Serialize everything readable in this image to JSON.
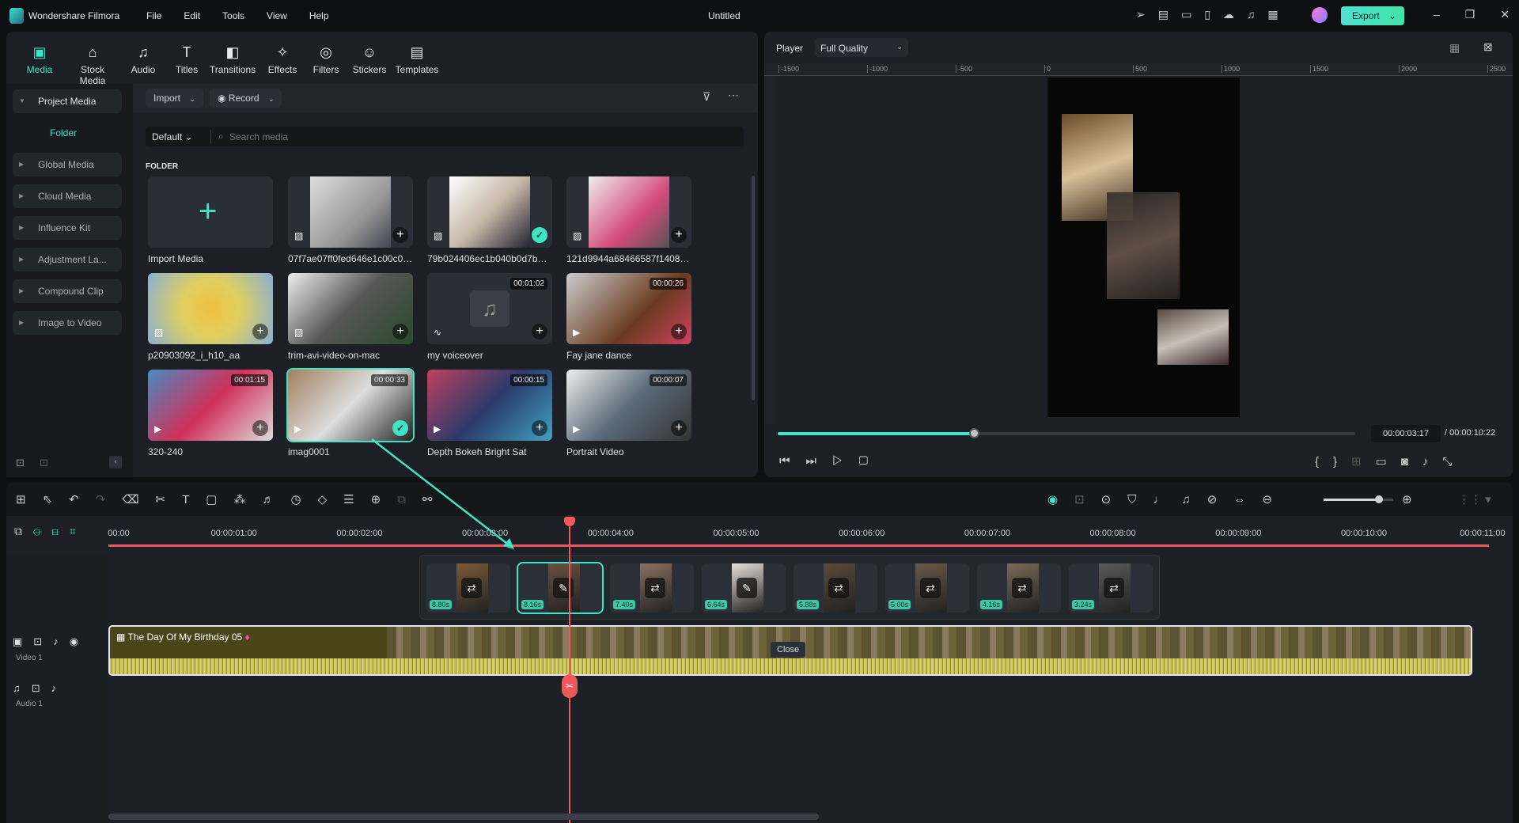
{
  "app": {
    "name": "Wondershare Filmora",
    "title": "Untitled",
    "export_label": "Export"
  },
  "menu": [
    "File",
    "Edit",
    "Tools",
    "View",
    "Help"
  ],
  "toolbar": [
    {
      "label": "Media",
      "icon": "media-icon",
      "active": true
    },
    {
      "label": "Stock Media",
      "icon": "store-icon"
    },
    {
      "label": "Audio",
      "icon": "music-icon"
    },
    {
      "label": "Titles",
      "icon": "text-icon"
    },
    {
      "label": "Transitions",
      "icon": "transition-icon"
    },
    {
      "label": "Effects",
      "icon": "effects-icon"
    },
    {
      "label": "Filters",
      "icon": "filter-icon"
    },
    {
      "label": "Stickers",
      "icon": "sticker-icon"
    },
    {
      "label": "Templates",
      "icon": "template-icon"
    }
  ],
  "sidebar": {
    "project_media": "Project Media",
    "folder": "Folder",
    "items": [
      "Global Media",
      "Cloud Media",
      "Influence Kit",
      "Adjustment La...",
      "Compound Clip",
      "Image to Video"
    ]
  },
  "media": {
    "import": "Import",
    "record": "Record",
    "sort": "Default",
    "search_placeholder": "Search media",
    "section": "FOLDER",
    "items": [
      {
        "name": "Import Media",
        "kind": "import"
      },
      {
        "name": "07f7ae07ff0fed646e1c00c057...",
        "kind": "image"
      },
      {
        "name": "79b024406ec1b040b0d7b8de...",
        "kind": "image",
        "used": true
      },
      {
        "name": "121d9944a68466587f1408607...",
        "kind": "image"
      },
      {
        "name": "p20903092_i_h10_aa",
        "kind": "image"
      },
      {
        "name": "trim-avi-video-on-mac",
        "kind": "image"
      },
      {
        "name": "my voiceover",
        "kind": "audio",
        "duration": "00:01:02"
      },
      {
        "name": "Fay jane dance",
        "kind": "video",
        "duration": "00:00:26"
      },
      {
        "name": "320-240",
        "kind": "video",
        "duration": "00:01:15"
      },
      {
        "name": "imag0001",
        "kind": "video",
        "duration": "00:00:33",
        "used": true,
        "selected": true
      },
      {
        "name": "Depth Bokeh Bright Sat",
        "kind": "video",
        "duration": "00:00:15"
      },
      {
        "name": "Portrait Video",
        "kind": "video",
        "duration": "00:00:07"
      }
    ]
  },
  "player": {
    "label": "Player",
    "quality": "Full Quality",
    "current_time": "00:00:03:17",
    "total_time": "/ 00:00:10:22",
    "progress": 0.34,
    "ruler": [
      "-1500",
      "-1000",
      "-500",
      "0",
      "500",
      "1000",
      "1500",
      "2000",
      "2500"
    ]
  },
  "timeline": {
    "ticks": [
      "00:00",
      "00:00:01:00",
      "00:00:02:00",
      "00:00:03:00",
      "00:00:04:00",
      "00:00:05:00",
      "00:00:06:00",
      "00:00:07:00",
      "00:00:08:00",
      "00:00:09:00",
      "00:00:10:00",
      "00:00:11:00"
    ],
    "clip_title": "The Day Of My Birthday 05",
    "close_tooltip": "Close",
    "video_track": "Video 1",
    "audio_track": "Audio 1",
    "track_num": "1",
    "popup_clips": [
      {
        "d": "8.80s",
        "o": "replace"
      },
      {
        "d": "8.16s",
        "o": "edit",
        "sel": true
      },
      {
        "d": "7.40s",
        "o": "replace"
      },
      {
        "d": "6.64s",
        "o": "edit"
      },
      {
        "d": "5.88s",
        "o": "replace"
      },
      {
        "d": "5.00s",
        "o": "replace"
      },
      {
        "d": "4.16s",
        "o": "replace"
      },
      {
        "d": "3.24s",
        "o": "replace"
      }
    ],
    "zoom_level": 0.8
  },
  "colors": {
    "accent": "#3ee5c4",
    "playhead": "#f0575b",
    "clip": "#4a4519",
    "wave": "#c9c35a"
  }
}
